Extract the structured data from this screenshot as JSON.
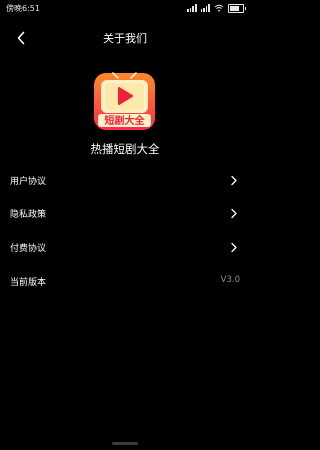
{
  "status_bar": {
    "time": "傍晚6:51",
    "battery_level": 0.75,
    "signal_bars": 4
  },
  "header": {
    "title": "关于我们"
  },
  "app": {
    "logo_text": "短剧大全",
    "name": "热播短剧大全",
    "logo_colors": {
      "orange": "#ff8a2a",
      "red": "#ff2b4a",
      "cream": "#fff1c7",
      "play_red": "#f11f38"
    }
  },
  "menu": {
    "user_agreement": "用户协议",
    "privacy_policy": "隐私政策",
    "payment_agreement": "付费协议",
    "current_version_label": "当前版本",
    "current_version_value": "V3.0"
  },
  "colors": {
    "background": "#000000",
    "text": "#ffffff",
    "muted": "#8e8e8e"
  }
}
